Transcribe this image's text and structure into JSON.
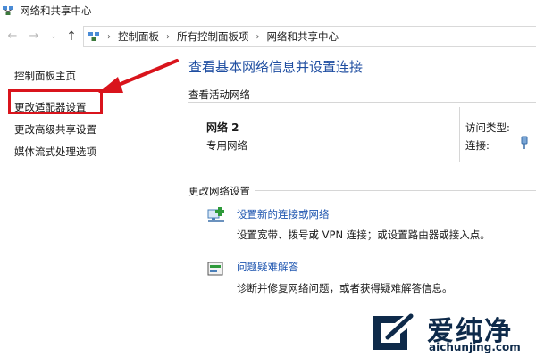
{
  "window": {
    "title": "网络和共享中心"
  },
  "nav": {
    "breadcrumbs": [
      "控制面板",
      "所有控制面板项",
      "网络和共享中心"
    ],
    "back_icon": "back-arrow-icon",
    "forward_icon": "forward-arrow-icon",
    "up_icon": "up-arrow-icon"
  },
  "sidebar": {
    "items": [
      {
        "label": "控制面板主页"
      },
      {
        "label": "更改适配器设置"
      },
      {
        "label": "更改高级共享设置"
      },
      {
        "label": "媒体流式处理选项"
      }
    ],
    "highlight_color": "#d9141c"
  },
  "main": {
    "heading": "查看基本网络信息并设置连接",
    "active_section": {
      "label": "查看活动网络",
      "network_name": "网络  2",
      "network_type": "专用网络",
      "access_type_label": "访问类型:",
      "connection_label": "连接:"
    },
    "change_section": {
      "label": "更改网络设置",
      "tasks": [
        {
          "link": "设置新的连接或网络",
          "desc": "设置宽带、拨号或 VPN 连接；或设置路由器或接入点。",
          "icon": "network-setup-icon"
        },
        {
          "link": "问题疑难解答",
          "desc": "诊断并修复网络问题，或者获得疑难解答信息。",
          "icon": "troubleshoot-icon"
        }
      ]
    }
  },
  "watermark": {
    "brand": "爱纯净",
    "url": "aichunjing.com"
  },
  "colors": {
    "heading": "#1f4ea1",
    "link": "#1f56b0",
    "annotation": "#d9141c"
  }
}
